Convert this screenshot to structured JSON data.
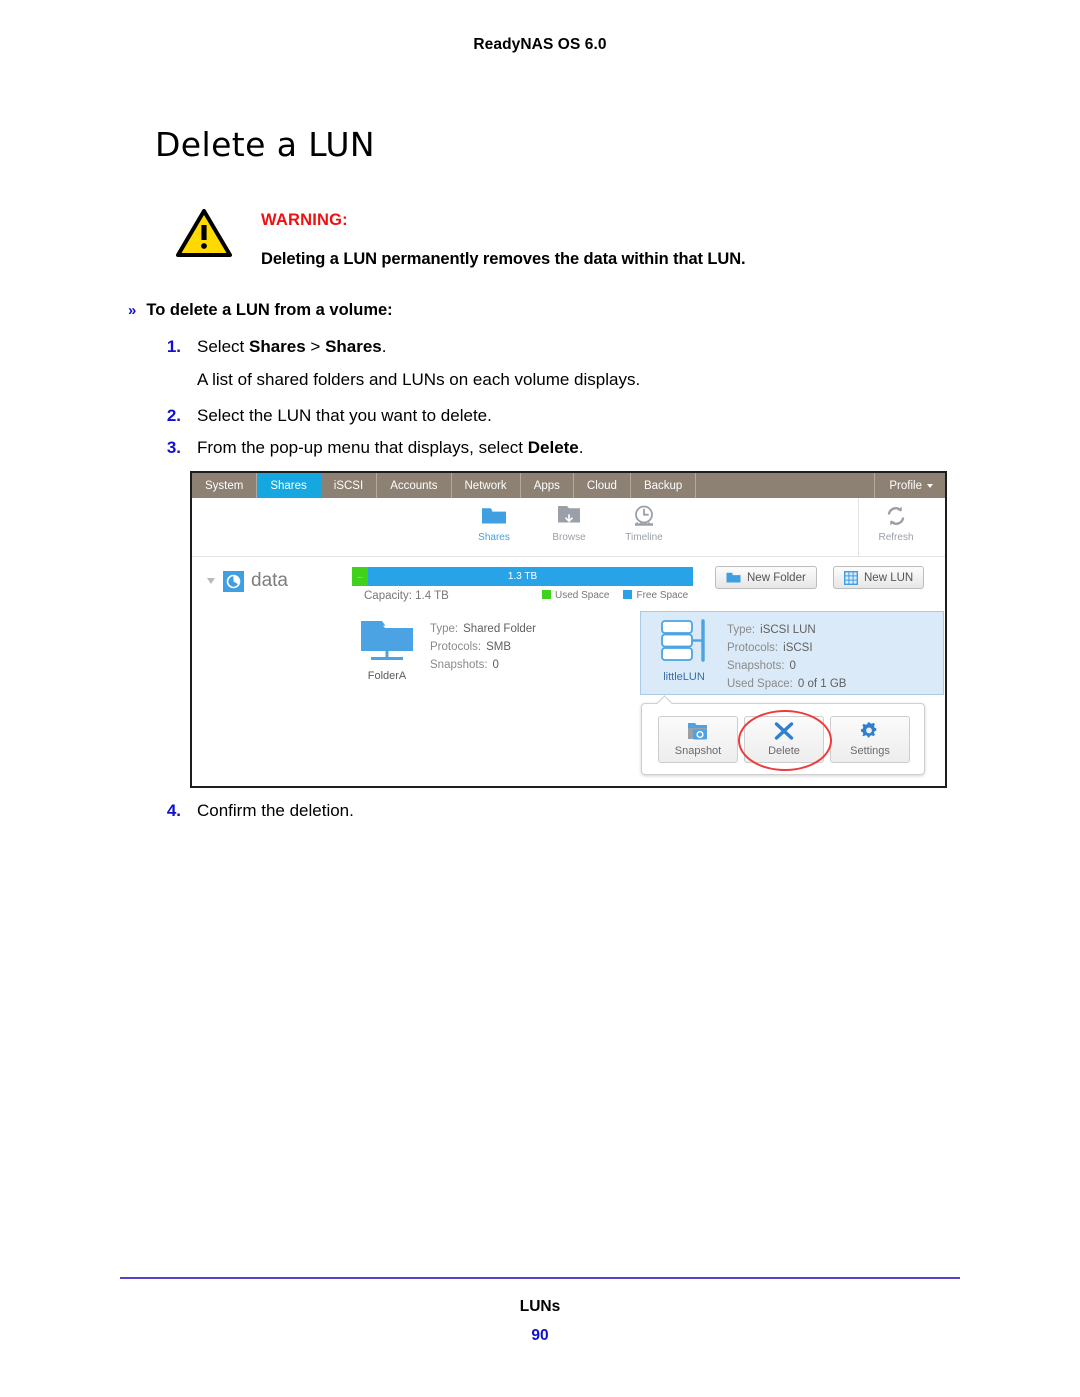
{
  "document": {
    "running_head": "ReadyNAS OS 6.0",
    "page_title": "Delete a LUN",
    "footer_title": "LUNs",
    "page_number": "90",
    "footer_rule_color": "#5a3fd0"
  },
  "warning": {
    "icon": "warning-triangle-icon",
    "label": "WARNING:",
    "label_color": "#ee1111",
    "text": "Deleting a LUN permanently removes the data within that LUN."
  },
  "procedure": {
    "bullet": "»",
    "heading": "To delete a LUN from a volume:",
    "steps": [
      {
        "num": "1.",
        "prefix": "Select ",
        "bold1": "Shares",
        "mid": " > ",
        "bold2": "Shares",
        "suffix": ".",
        "sub": "A list of shared folders and LUNs on each volume displays."
      },
      {
        "num": "2.",
        "text": "Select the LUN that you want to delete."
      },
      {
        "num": "3.",
        "prefix": "From the pop-up menu that displays, select ",
        "bold1": "Delete",
        "suffix": "."
      },
      {
        "num": "4.",
        "text": "Confirm the deletion."
      }
    ]
  },
  "screenshot": {
    "navbar": {
      "tabs": [
        {
          "label": "System",
          "active": false
        },
        {
          "label": "Shares",
          "active": true
        },
        {
          "label": "iSCSI",
          "active": false
        },
        {
          "label": "Accounts",
          "active": false
        },
        {
          "label": "Network",
          "active": false
        },
        {
          "label": "Apps",
          "active": false
        },
        {
          "label": "Cloud",
          "active": false
        },
        {
          "label": "Backup",
          "active": false
        }
      ],
      "profile_label": "Profile",
      "active_color": "#16a7e0",
      "bar_color": "#8c8172"
    },
    "toolbar": {
      "items": [
        {
          "label": "Shares",
          "icon": "folder-icon",
          "active": true
        },
        {
          "label": "Browse",
          "icon": "folder-download-icon",
          "active": false
        },
        {
          "label": "Timeline",
          "icon": "clock-icon",
          "active": false
        }
      ],
      "refresh": {
        "label": "Refresh",
        "icon": "refresh-icon"
      }
    },
    "volume": {
      "name": "data",
      "icon": "volume-pie-icon",
      "free_label": "1.3 TB",
      "capacity_label": "Capacity: 1.4 TB",
      "legend": [
        {
          "label": "Used Space",
          "color": "#3fd11c"
        },
        {
          "label": "Free Space",
          "color": "#29a3e8"
        }
      ],
      "buttons": [
        {
          "label": "New Folder",
          "icon": "folder-icon"
        },
        {
          "label": "New LUN",
          "icon": "lun-grid-icon"
        }
      ]
    },
    "cards": [
      {
        "name": "FolderA",
        "icon": "shared-folder-icon",
        "selected": false,
        "props": [
          {
            "key": "Type:",
            "value": "Shared Folder"
          },
          {
            "key": "Protocols:",
            "value": "SMB"
          },
          {
            "key": "Snapshots:",
            "value": "0"
          }
        ]
      },
      {
        "name": "littleLUN",
        "icon": "lun-stack-icon",
        "selected": true,
        "props": [
          {
            "key": "Type:",
            "value": "iSCSI LUN"
          },
          {
            "key": "Protocols:",
            "value": "iSCSI"
          },
          {
            "key": "Snapshots:",
            "value": "0"
          },
          {
            "key": "Used Space:",
            "value": "0 of 1 GB"
          }
        ]
      }
    ],
    "popup_menu": {
      "buttons": [
        {
          "label": "Snapshot",
          "icon": "snapshot-camera-icon",
          "highlighted": false
        },
        {
          "label": "Delete",
          "icon": "x-delete-icon",
          "highlighted": true
        },
        {
          "label": "Settings",
          "icon": "gear-icon",
          "highlighted": false
        }
      ],
      "annotation_color": "#ee3b3b"
    }
  }
}
